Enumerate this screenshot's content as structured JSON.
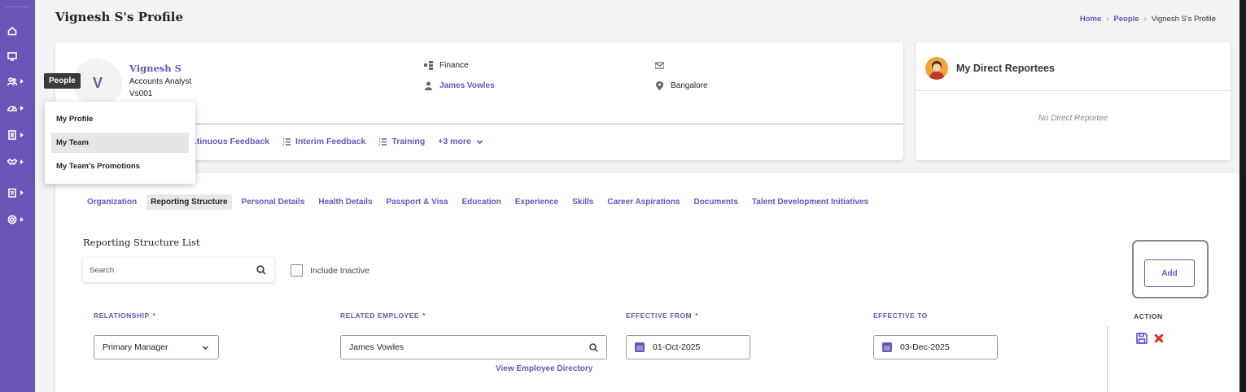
{
  "page": {
    "title": "Vignesh S's Profile"
  },
  "breadcrumb": {
    "home": "Home",
    "people": "People",
    "current": "Vignesh S's Profile"
  },
  "rail": {
    "items": [
      "home-icon",
      "monitor-icon",
      "people-icon",
      "dashboard-icon",
      "document-icon",
      "handshake-icon",
      "clipboard-icon",
      "settings-icon"
    ]
  },
  "profile": {
    "initial": "V",
    "name": "Vignesh S",
    "role": "Accounts Analyst",
    "code": "Vs001",
    "department": "Finance",
    "manager": "James Vowles",
    "location": "Bangalore",
    "tabs": [
      "...tinuous Feedback",
      "Interim Feedback",
      "Training",
      "+3 more"
    ]
  },
  "reportees": {
    "title": "My Direct Reportees",
    "empty": "No Direct Reportee"
  },
  "subtabs": [
    "Organization",
    "Reporting Structure",
    "Personal Details",
    "Health Details",
    "Passport & Visa",
    "Education",
    "Experience",
    "Skills",
    "Career Aspirations",
    "Documents",
    "Talent Development Initiatives"
  ],
  "section": {
    "title": "Reporting Structure List",
    "search_placeholder": "Search",
    "include_inactive": "Include Inactive",
    "add": "Add"
  },
  "columns": {
    "relationship": "RELATIONSHIP",
    "related_employee": "RELATED EMPLOYEE",
    "effective_from": "EFFECTIVE FROM",
    "effective_to": "EFFECTIVE TO",
    "action": "ACTION",
    "required": "*"
  },
  "row": {
    "relationship": "Primary Manager",
    "related_employee": "James Vowles",
    "view_directory": "View Employee Directory",
    "effective_from": "01-Oct-2025",
    "effective_to": "03-Dec-2025"
  },
  "popup": {
    "tooltip": "People",
    "items": [
      "My Profile",
      "My Team",
      "My Team's Promotions"
    ],
    "active_index": 1
  },
  "colors": {
    "accent": "#6a55b8",
    "danger": "#e3261c",
    "rail": "#6a55b8"
  }
}
